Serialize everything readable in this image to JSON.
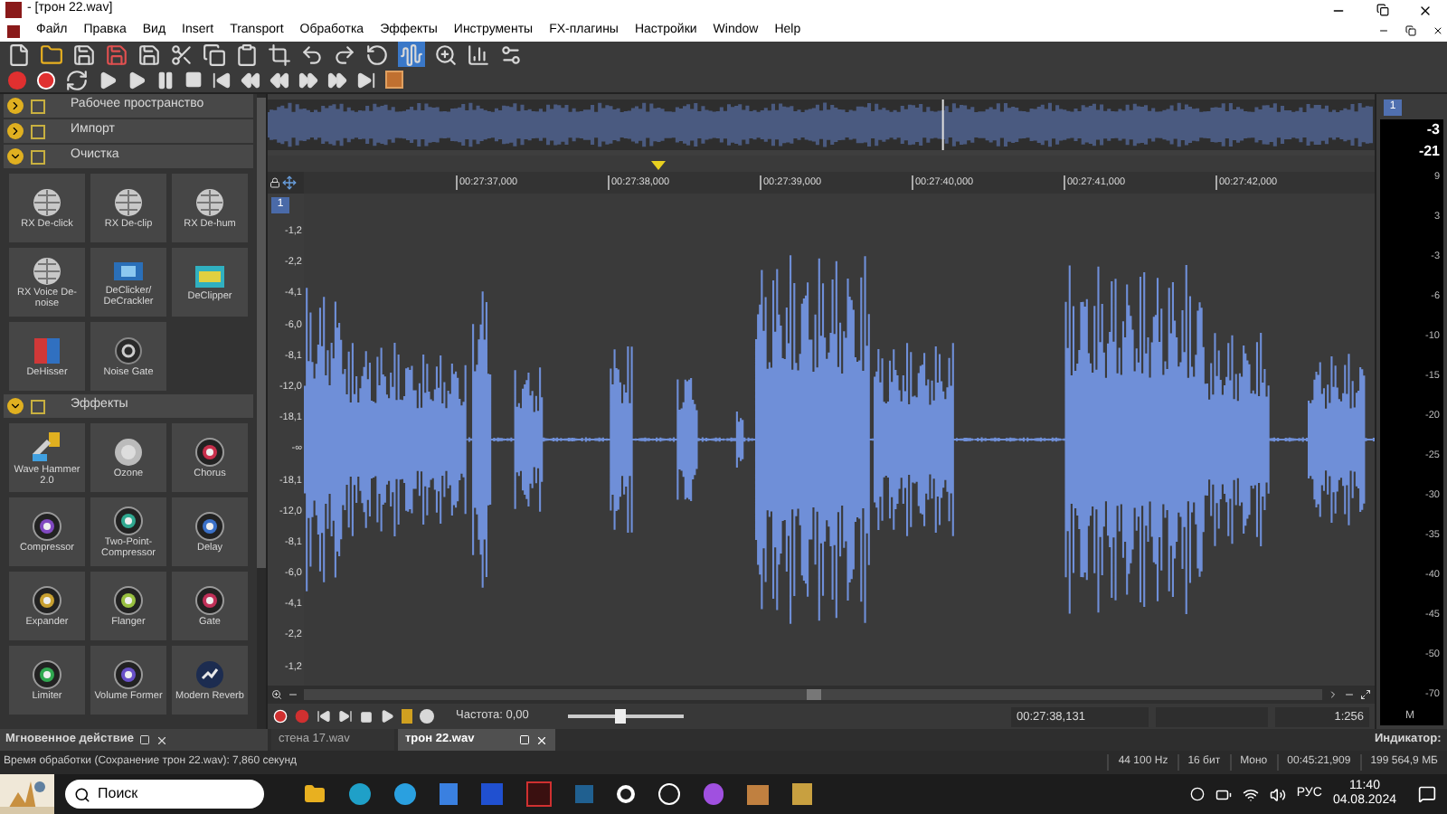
{
  "window": {
    "title": "- [трон 22.wav]"
  },
  "menu": [
    "Файл",
    "Правка",
    "Вид",
    "Insert",
    "Transport",
    "Обработка",
    "Эффекты",
    "Инструменты",
    "FX-плагины",
    "Настройки",
    "Window",
    "Help"
  ],
  "toolbar": {
    "waveform_view_selected": true
  },
  "panel": {
    "sections": [
      {
        "title": "Рабочее пространство",
        "expanded": false
      },
      {
        "title": "Импорт",
        "expanded": false
      },
      {
        "title": "Очистка",
        "expanded": true,
        "items": [
          {
            "label": "RX De-click",
            "kind": "sphere"
          },
          {
            "label": "RX De-clip",
            "kind": "sphere"
          },
          {
            "label": "RX De-hum",
            "kind": "sphere"
          },
          {
            "label": "RX Voice De-noise",
            "kind": "sphere"
          },
          {
            "label": "DeClicker/ DeCrackler",
            "kind": "declicker"
          },
          {
            "label": "DeClipper",
            "kind": "declipper"
          },
          {
            "label": "DeHisser",
            "kind": "dehisser"
          },
          {
            "label": "Noise Gate",
            "kind": "gate"
          }
        ]
      },
      {
        "title": "Эффекты",
        "expanded": true,
        "items": [
          {
            "label": "Wave Hammer 2.0",
            "kind": "hammer"
          },
          {
            "label": "Ozone",
            "kind": "ozone"
          },
          {
            "label": "Chorus",
            "kind": "ring",
            "color": "#c8304c"
          },
          {
            "label": "Compressor",
            "kind": "ring",
            "color": "#8048c0"
          },
          {
            "label": "Two-Point-Compressor",
            "kind": "ring",
            "color": "#30a890"
          },
          {
            "label": "Delay",
            "kind": "ring",
            "color": "#3a70c8"
          },
          {
            "label": "Expander",
            "kind": "ring",
            "color": "#c8a030"
          },
          {
            "label": "Flanger",
            "kind": "ring",
            "color": "#98c040"
          },
          {
            "label": "Gate",
            "kind": "ring",
            "color": "#c03058"
          },
          {
            "label": "Limiter",
            "kind": "ring",
            "color": "#30a850"
          },
          {
            "label": "Volume Former",
            "kind": "ring",
            "color": "#6850c8"
          },
          {
            "label": "Modern Reverb",
            "kind": "reverb"
          }
        ]
      }
    ]
  },
  "track": {
    "number": "1"
  },
  "ruler": [
    "00:27:37,000",
    "00:27:38,000",
    "00:27:39,000",
    "00:27:40,000",
    "00:27:41,000",
    "00:27:42,000"
  ],
  "db_scale": [
    "-1,2",
    "-2,2",
    "-4,1",
    "-6,0",
    "-8,1",
    "-12,0",
    "-18,1",
    "-∞",
    "-18,1",
    "-12,0",
    "-8,1",
    "-6,0",
    "-4,1",
    "-2,2",
    "-1,2"
  ],
  "transport": {
    "rate_label": "Частота: 0,00",
    "rate": {
      "level": 0.45
    },
    "time": "00:27:38,131",
    "zoom": "1:256"
  },
  "meter": {
    "channel": "1",
    "peak": "-3",
    "level_reading": "-21",
    "scale": [
      "9",
      "3",
      "-3",
      "-6",
      "-10",
      "-15",
      "-20",
      "-25",
      "-30",
      "-35",
      "-40",
      "-45",
      "-50",
      "-70"
    ],
    "mode": "M"
  },
  "tabs": [
    {
      "label": "стена 17.wav",
      "selected": false
    },
    {
      "label": "трон 22.wav",
      "selected": true
    }
  ],
  "panel_tab": "Мгновенное действие",
  "meter_tab": "Индикатор:",
  "status_bar": {
    "message": "Время обработки (Сохранение трон 22.wav): 7,860 секунд",
    "fields": [
      "44 100 Hz",
      "16 бит",
      "Моно",
      "00:45:21,909",
      "199 564,9 МБ"
    ]
  },
  "taskbar": {
    "search": "Поиск",
    "language": "РУС",
    "time": "11:40",
    "date": "04.08.2024"
  }
}
